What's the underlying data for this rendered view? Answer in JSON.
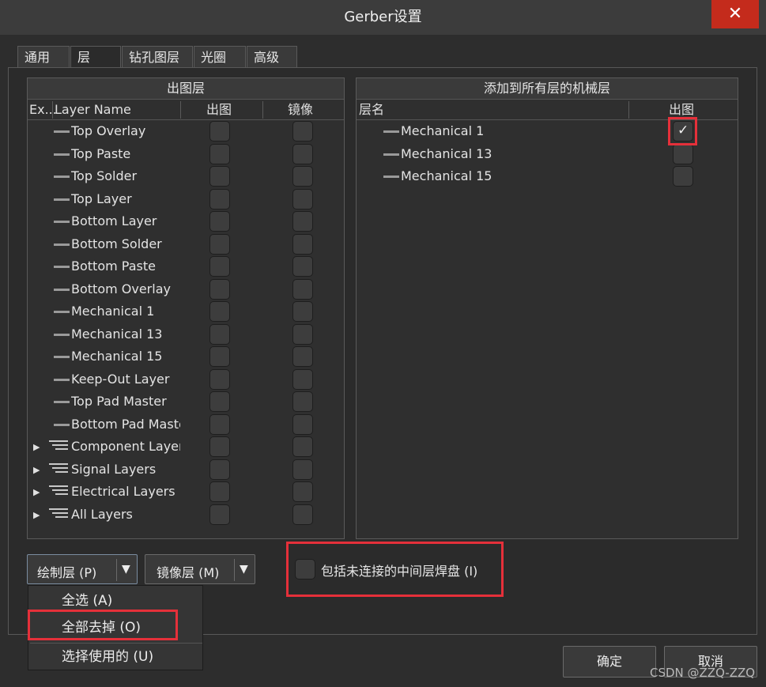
{
  "window": {
    "title": "Gerber设置",
    "close_glyph": "✕"
  },
  "tabs": [
    {
      "label": "通用"
    },
    {
      "label": "层"
    },
    {
      "label": "钻孔图层"
    },
    {
      "label": "光圈"
    },
    {
      "label": "高级"
    }
  ],
  "left_panel": {
    "title": "出图层",
    "columns": {
      "ex": "Ex...",
      "name": "Layer Name",
      "plot": "出图",
      "mirror": "镜像"
    },
    "layers": [
      {
        "name": "Top Overlay"
      },
      {
        "name": "Top Paste"
      },
      {
        "name": "Top Solder"
      },
      {
        "name": "Top Layer"
      },
      {
        "name": "Bottom Layer"
      },
      {
        "name": "Bottom Solder"
      },
      {
        "name": "Bottom Paste"
      },
      {
        "name": "Bottom Overlay"
      },
      {
        "name": "Mechanical 1"
      },
      {
        "name": "Mechanical 13"
      },
      {
        "name": "Mechanical 15"
      },
      {
        "name": "Keep-Out Layer"
      },
      {
        "name": "Top Pad Master"
      },
      {
        "name": "Bottom Pad Maste"
      }
    ],
    "groups": [
      {
        "name": "Component Layers"
      },
      {
        "name": "Signal Layers"
      },
      {
        "name": "Electrical Layers"
      },
      {
        "name": "All Layers"
      }
    ]
  },
  "right_panel": {
    "title": "添加到所有层的机械层",
    "columns": {
      "name": "层名",
      "plot": "出图"
    },
    "layers": [
      {
        "name": "Mechanical 1",
        "checked": true
      },
      {
        "name": "Mechanical 13",
        "checked": false
      },
      {
        "name": "Mechanical 15",
        "checked": false
      }
    ]
  },
  "buttons": {
    "plot_layers": "绘制层 (P)",
    "mirror_layers": "镜像层 (M)",
    "ok": "确定",
    "cancel": "取消"
  },
  "checkbox_include": {
    "label": "包括未连接的中间层焊盘 (I)",
    "checked": false
  },
  "dropdown_menu": [
    {
      "label": "全选 (A)"
    },
    {
      "label": "全部去掉 (O)"
    },
    {
      "label": "选择使用的 (U)"
    }
  ],
  "watermark": "CSDN @ZZQ-ZZQ",
  "colors": {
    "highlight_red": "#e5303a",
    "close_red": "#c42b1c",
    "background": "#2d2d2d"
  }
}
